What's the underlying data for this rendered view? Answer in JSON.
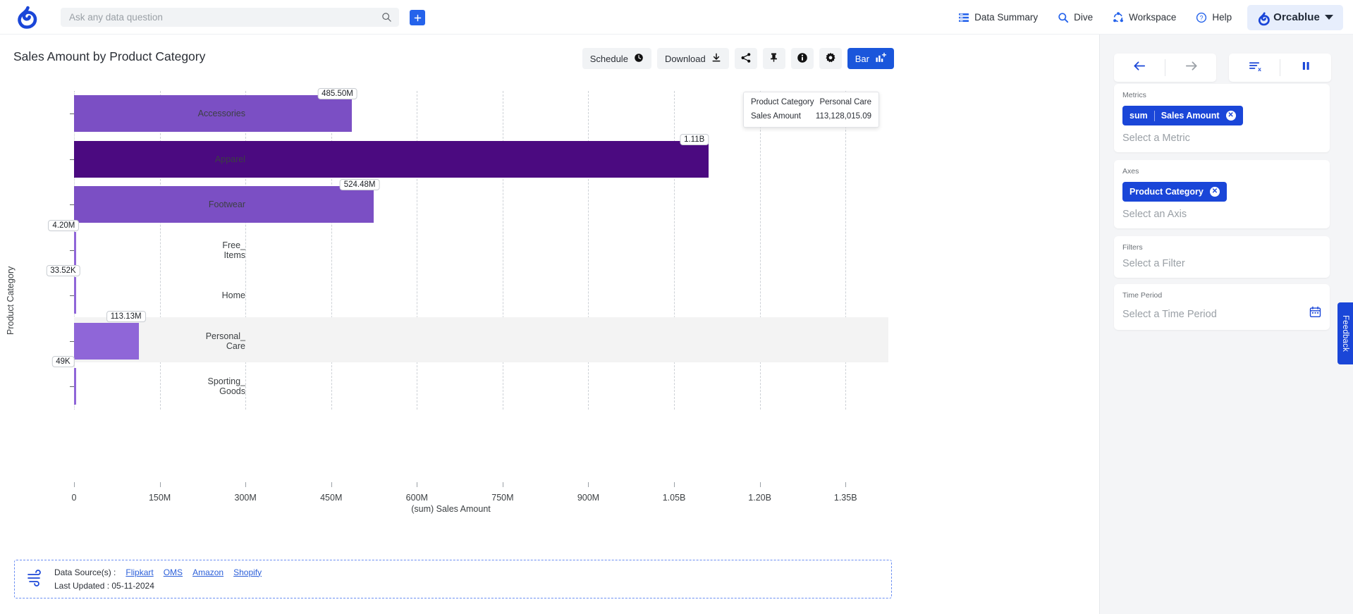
{
  "topnav": {
    "logo_icon": "orca-logo-icon",
    "search": {
      "placeholder": "Ask any data question",
      "value": "",
      "icon": "search-icon"
    },
    "add_button_label": "+",
    "items": [
      {
        "label": "Data Summary",
        "icon": "data-summary-icon"
      },
      {
        "label": "Dive",
        "icon": "search-icon"
      },
      {
        "label": "Workspace",
        "icon": "workspace-icon"
      },
      {
        "label": "Help",
        "icon": "help-icon"
      }
    ],
    "workspace": {
      "name": "Orcablue",
      "icon": "orca-logo-icon",
      "caret": "chevron-down-icon"
    }
  },
  "header": {
    "title": "Sales Amount by Product Category",
    "toolbar": [
      {
        "name": "schedule",
        "label": "Schedule",
        "icon": "clock-icon"
      },
      {
        "name": "download",
        "label": "Download",
        "icon": "download-icon"
      },
      {
        "name": "share",
        "label": "",
        "icon": "share-icon"
      },
      {
        "name": "pin",
        "label": "",
        "icon": "pin-icon"
      },
      {
        "name": "info",
        "label": "",
        "icon": "info-icon"
      },
      {
        "name": "settings",
        "label": "",
        "icon": "gear-icon"
      },
      {
        "name": "chart-type",
        "label": "Bar",
        "icon": "bar-chart-plus-icon"
      }
    ]
  },
  "chart_data": {
    "type": "bar",
    "orientation": "horizontal",
    "title": "Sales Amount by Product Category",
    "xlabel": "(sum) Sales Amount",
    "ylabel": "Product Category",
    "xlim": [
      0,
      1425000000
    ],
    "grid": true,
    "legend": false,
    "categories": [
      "Accessories",
      "Apparel",
      "Footwear",
      "Free_Items",
      "Home",
      "Personal_Care",
      "Sporting_Goods"
    ],
    "values": [
      485500000,
      1110000000,
      524480000,
      4200000,
      33520,
      113130000,
      49000
    ],
    "data_labels": [
      "485.50M",
      "1.11B",
      "524.48M",
      "4.20M",
      "33.52K",
      "113.13M",
      "49K"
    ],
    "colors": [
      "#7b4fc4",
      "#4b0a80",
      "#7b4fc4",
      "#8f66d8",
      "#8f66d8",
      "#8f66d8",
      "#8f66d8"
    ],
    "highlighted_category": "Personal_Care",
    "xticks": [
      {
        "label": "0",
        "value": 0
      },
      {
        "label": "150M",
        "value": 150000000
      },
      {
        "label": "300M",
        "value": 300000000
      },
      {
        "label": "450M",
        "value": 450000000
      },
      {
        "label": "600M",
        "value": 600000000
      },
      {
        "label": "750M",
        "value": 750000000
      },
      {
        "label": "900M",
        "value": 900000000
      },
      {
        "label": "1.05B",
        "value": 1050000000
      },
      {
        "label": "1.20B",
        "value": 1200000000
      },
      {
        "label": "1.35B",
        "value": 1350000000
      }
    ]
  },
  "tooltip": {
    "rows": [
      {
        "key": "Product Category",
        "value": "Personal Care"
      },
      {
        "key": "Sales Amount",
        "value": "113,128,015.09"
      }
    ]
  },
  "footer": {
    "icon": "data-flow-icon",
    "sources_label": "Data Source(s) :",
    "sources": [
      "Flipkart",
      "OMS",
      "Amazon",
      "Shopify"
    ],
    "last_updated_label": "Last Updated : 05-11-2024"
  },
  "rightpanel": {
    "nav": [
      {
        "name": "back",
        "icon": "arrow-left-icon",
        "state": "enabled"
      },
      {
        "name": "forward",
        "icon": "arrow-right-icon",
        "state": "disabled"
      }
    ],
    "actions": [
      {
        "name": "clear-filters",
        "icon": "clear-list-icon"
      },
      {
        "name": "pause",
        "icon": "pause-icon"
      }
    ],
    "metrics": {
      "label": "Metrics",
      "chips": [
        {
          "agg": "sum",
          "field": "Sales Amount",
          "remove_icon": "close-circle-icon"
        }
      ],
      "placeholder": "Select a Metric"
    },
    "axes": {
      "label": "Axes",
      "chips": [
        {
          "field": "Product Category",
          "remove_icon": "close-circle-icon"
        }
      ],
      "placeholder": "Select an Axis"
    },
    "filters": {
      "label": "Filters",
      "placeholder": "Select a Filter"
    },
    "time_period": {
      "label": "Time Period",
      "placeholder": "Select a Time Period",
      "icon": "calendar-icon"
    }
  },
  "feedback": {
    "label": "Feedback"
  },
  "colors": {
    "accent": "#1a46d8",
    "brand": "#2563eb",
    "bar_primary": "#7b4fc4",
    "bar_dark": "#4b0a80",
    "bar_light": "#8f66d8"
  }
}
